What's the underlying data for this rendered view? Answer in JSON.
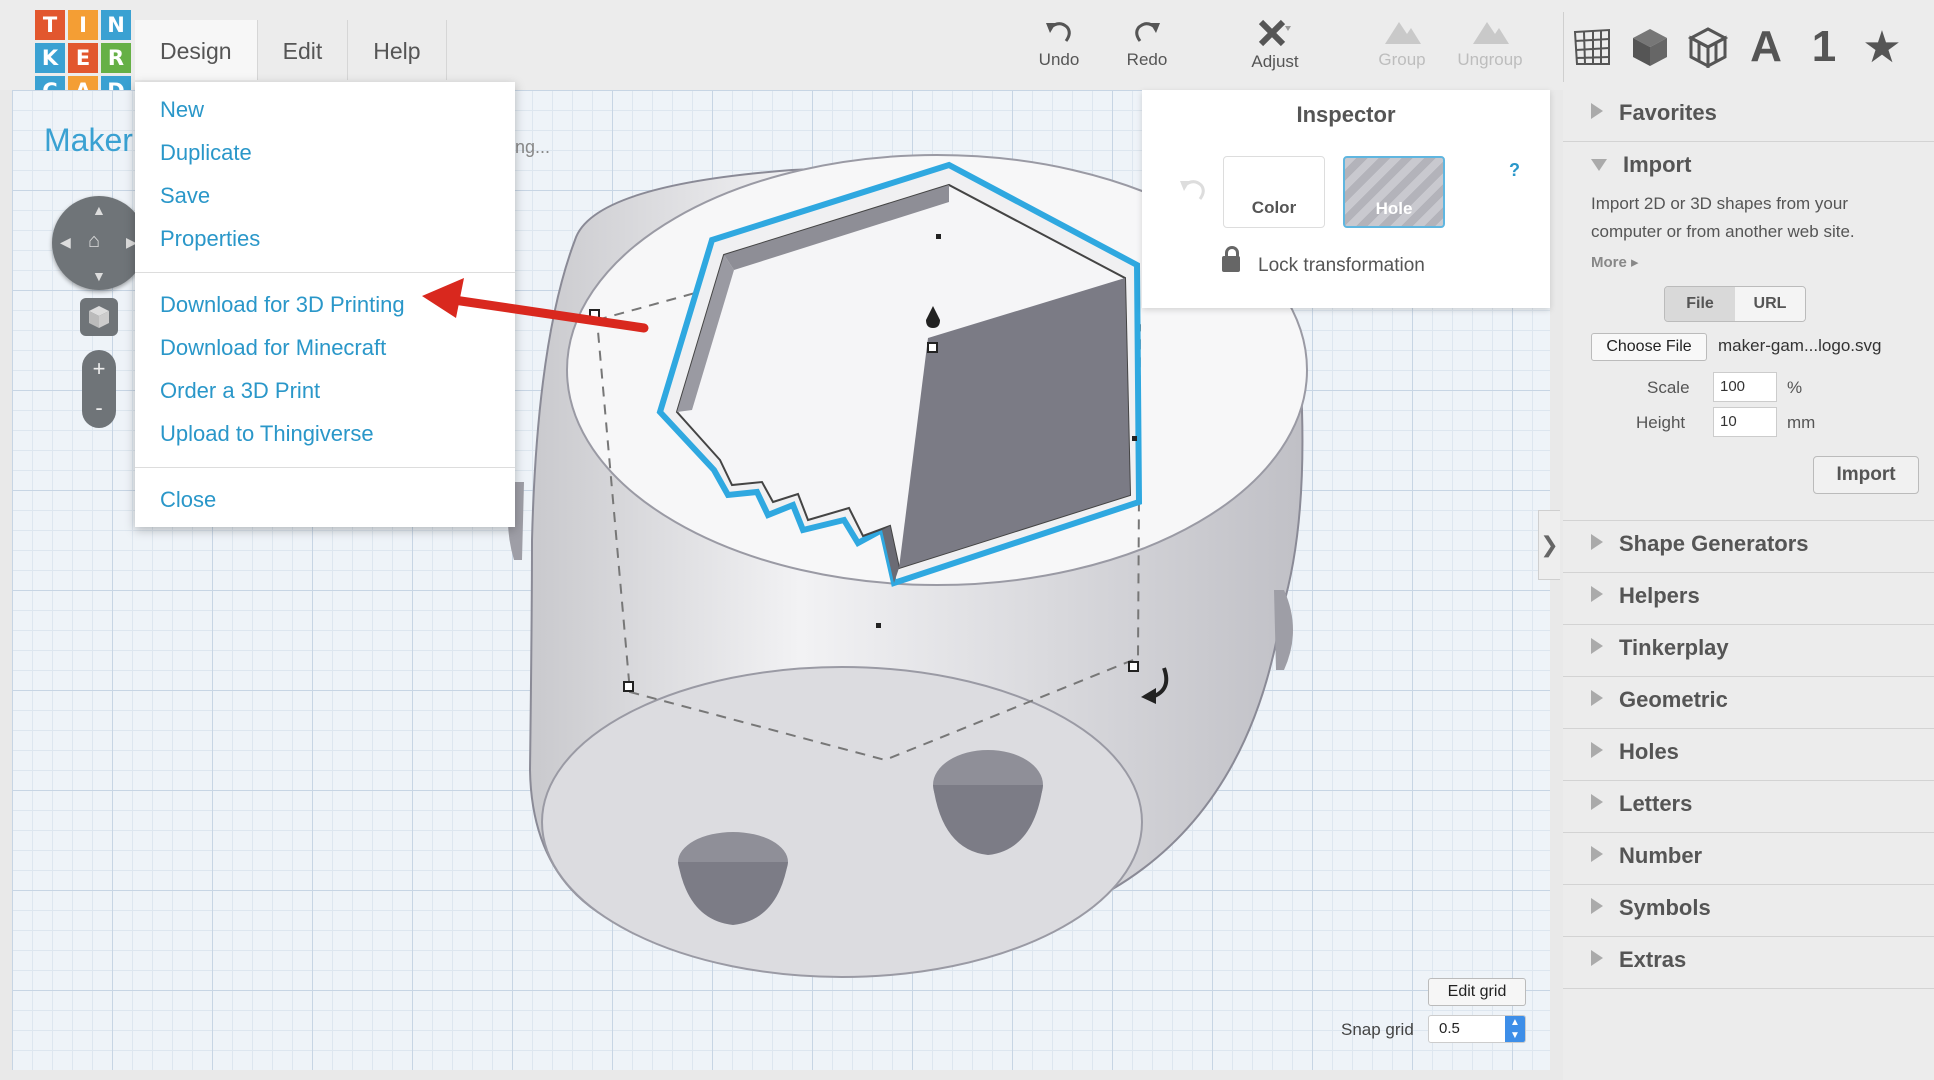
{
  "logo": {
    "letters": [
      "T",
      "I",
      "N",
      "K",
      "E",
      "R",
      "C",
      "A",
      "D"
    ],
    "colors": [
      "#e2572e",
      "#f49e34",
      "#3aa1d2",
      "#3aa1d2",
      "#e2572e",
      "#66b046",
      "#3aa1d2",
      "#f49e34",
      "#3aa1d2"
    ]
  },
  "menubar": {
    "design": "Design",
    "edit": "Edit",
    "help": "Help"
  },
  "toolbar": {
    "undo": "Undo",
    "redo": "Redo",
    "adjust": "Adjust",
    "group": "Group",
    "ungroup": "Ungroup"
  },
  "panel_tabs": {
    "letters_tab": "A",
    "number_tab": "1",
    "favorites_tab": "★"
  },
  "design_title": "Maker",
  "saving_text": "ng...",
  "dropdown": {
    "items_top": [
      "New",
      "Duplicate",
      "Save",
      "Properties"
    ],
    "items_mid": [
      "Download for 3D Printing",
      "Download for Minecraft",
      "Order a 3D Print",
      "Upload to Thingiverse"
    ],
    "close": "Close"
  },
  "inspector": {
    "title": "Inspector",
    "color": "Color",
    "hole": "Hole",
    "help": "?",
    "lock": "Lock transformation"
  },
  "rpanel": {
    "favorites": "Favorites",
    "import": "Import",
    "import_desc": "Import 2D or 3D shapes from your computer or from another web site.",
    "more": "More ▸",
    "file_tab": "File",
    "url_tab": "URL",
    "choose_file": "Choose File",
    "file_name": "maker-gam...logo.svg",
    "scale_label": "Scale",
    "scale_value": "100",
    "scale_unit": "%",
    "height_label": "Height",
    "height_value": "10",
    "height_unit": "mm",
    "import_button": "Import",
    "sections": [
      "Shape Generators",
      "Helpers",
      "Tinkerplay",
      "Geometric",
      "Holes",
      "Letters",
      "Number",
      "Symbols",
      "Extras"
    ]
  },
  "grid": {
    "edit_grid": "Edit grid",
    "snap_label": "Snap grid",
    "snap_value": "0.5"
  }
}
